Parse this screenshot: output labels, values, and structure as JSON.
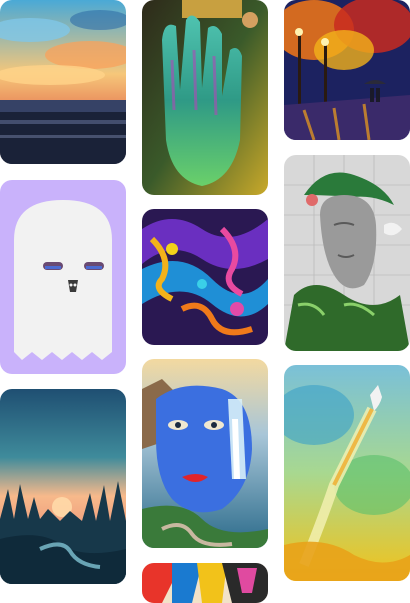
{
  "gallery": {
    "columns": 3,
    "items": [
      {
        "id": "sunset-clouds-lake",
        "column": 1,
        "type": "painting"
      },
      {
        "id": "ghost-sticker",
        "column": 1,
        "type": "illustration"
      },
      {
        "id": "forest-sunrise-river",
        "column": 1,
        "type": "illustration"
      },
      {
        "id": "neon-hand",
        "column": 2,
        "type": "painting"
      },
      {
        "id": "psychedelic-swirls",
        "column": 2,
        "type": "abstract"
      },
      {
        "id": "blue-face-waterfall",
        "column": 2,
        "type": "surreal"
      },
      {
        "id": "colorful-portrait-partial",
        "column": 2,
        "type": "painting"
      },
      {
        "id": "autumn-park-rain",
        "column": 3,
        "type": "painting"
      },
      {
        "id": "statue-with-leaves",
        "column": 3,
        "type": "collage"
      },
      {
        "id": "watercolor-rocket",
        "column": 3,
        "type": "watercolor"
      }
    ]
  },
  "colors": {
    "background": "#ffffff",
    "ghost_bg": "#c9b2fb",
    "ghost_body": "#f2f2f2"
  }
}
